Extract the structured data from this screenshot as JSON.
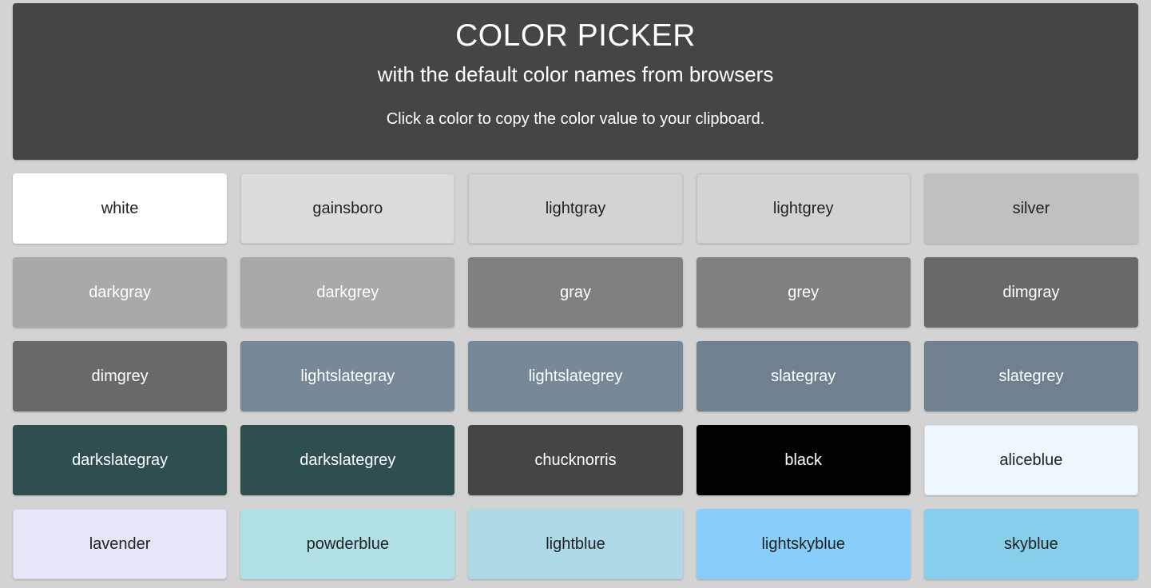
{
  "header": {
    "title": "COLOR PICKER",
    "subtitle": "with the default color names from browsers",
    "note": "Click a color to copy the color value to your clipboard.",
    "background": "#454545",
    "text_color": "#ffffff"
  },
  "page": {
    "background": "#d3d3d3"
  },
  "grid": {
    "columns": 5,
    "rows": 5,
    "swatches": [
      {
        "label": "white",
        "color": "#ffffff",
        "text": "#222222",
        "bordered": false
      },
      {
        "label": "gainsboro",
        "color": "#dcdcdc",
        "text": "#222222",
        "bordered": true
      },
      {
        "label": "lightgray",
        "color": "#d3d3d3",
        "text": "#222222",
        "bordered": true
      },
      {
        "label": "lightgrey",
        "color": "#d3d3d3",
        "text": "#222222",
        "bordered": true
      },
      {
        "label": "silver",
        "color": "#c0c0c0",
        "text": "#222222",
        "bordered": false
      },
      {
        "label": "darkgray",
        "color": "#a9a9a9",
        "text": "#ffffff",
        "bordered": false
      },
      {
        "label": "darkgrey",
        "color": "#a9a9a9",
        "text": "#ffffff",
        "bordered": false
      },
      {
        "label": "gray",
        "color": "#808080",
        "text": "#ffffff",
        "bordered": false
      },
      {
        "label": "grey",
        "color": "#808080",
        "text": "#ffffff",
        "bordered": false
      },
      {
        "label": "dimgray",
        "color": "#696969",
        "text": "#ffffff",
        "bordered": false
      },
      {
        "label": "dimgrey",
        "color": "#696969",
        "text": "#ffffff",
        "bordered": false
      },
      {
        "label": "lightslategray",
        "color": "#778899",
        "text": "#ffffff",
        "bordered": false
      },
      {
        "label": "lightslategrey",
        "color": "#778899",
        "text": "#ffffff",
        "bordered": false
      },
      {
        "label": "slategray",
        "color": "#708090",
        "text": "#ffffff",
        "bordered": false
      },
      {
        "label": "slategrey",
        "color": "#708090",
        "text": "#ffffff",
        "bordered": false
      },
      {
        "label": "darkslategray",
        "color": "#2f4f4f",
        "text": "#ffffff",
        "bordered": false
      },
      {
        "label": "darkslategrey",
        "color": "#2f4f4f",
        "text": "#ffffff",
        "bordered": false
      },
      {
        "label": "chucknorris",
        "color": "#454545",
        "text": "#ffffff",
        "bordered": false
      },
      {
        "label": "black",
        "color": "#000000",
        "text": "#ffffff",
        "bordered": false
      },
      {
        "label": "aliceblue",
        "color": "#f0f8ff",
        "text": "#222222",
        "bordered": true
      },
      {
        "label": "lavender",
        "color": "#e6e6fa",
        "text": "#222222",
        "bordered": true
      },
      {
        "label": "powderblue",
        "color": "#b0e0e6",
        "text": "#222222",
        "bordered": false
      },
      {
        "label": "lightblue",
        "color": "#add8e6",
        "text": "#222222",
        "bordered": false
      },
      {
        "label": "lightskyblue",
        "color": "#87cefa",
        "text": "#222222",
        "bordered": false
      },
      {
        "label": "skyblue",
        "color": "#87ceeb",
        "text": "#222222",
        "bordered": false
      }
    ]
  }
}
